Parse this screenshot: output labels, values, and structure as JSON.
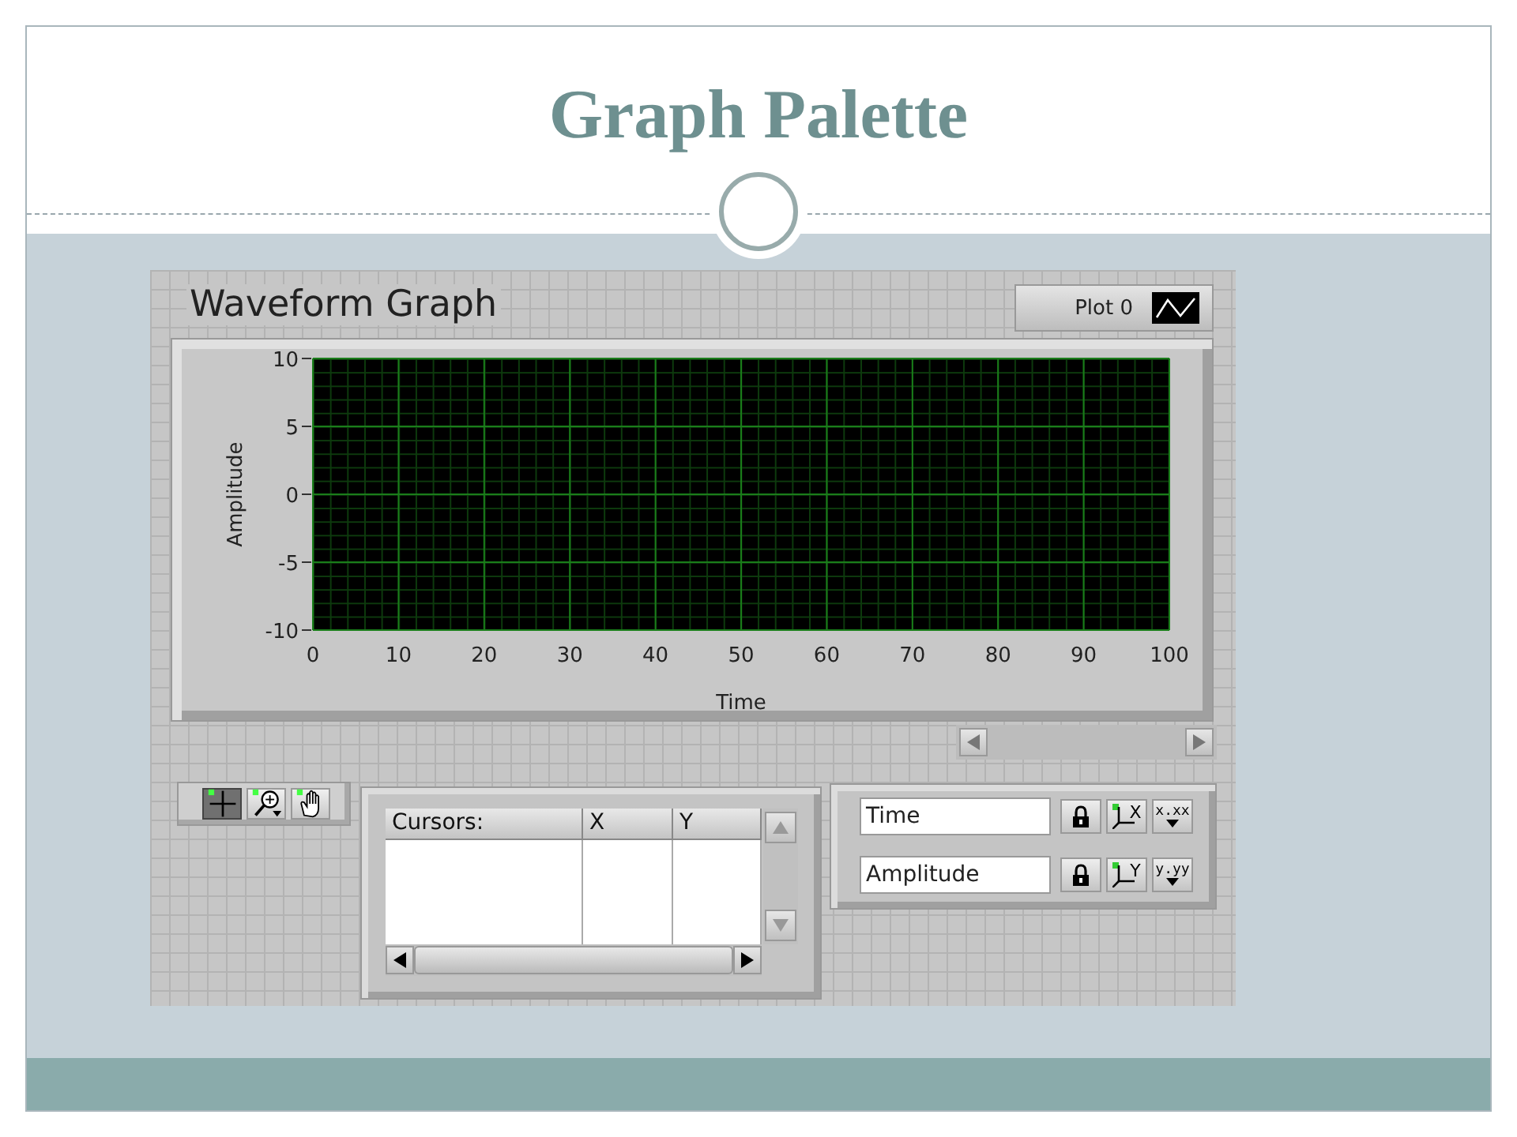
{
  "slide": {
    "title": "Graph Palette"
  },
  "graph": {
    "label": "Waveform Graph",
    "legend": {
      "plot": "Plot 0"
    },
    "chart_data": {
      "type": "line",
      "grid": true,
      "xlabel": "Time",
      "ylabel": "Amplitude",
      "xlim": [
        0,
        100
      ],
      "ylim": [
        -10,
        10
      ],
      "xticks": [
        0,
        10,
        20,
        30,
        40,
        50,
        60,
        70,
        80,
        90,
        100
      ],
      "yticks": [
        -10,
        -5,
        0,
        5,
        10
      ]
    }
  },
  "palette": {
    "tools": [
      {
        "kind": "cursor",
        "selected": true
      },
      {
        "kind": "zoom",
        "selected": false
      },
      {
        "kind": "pan",
        "selected": false
      }
    ]
  },
  "cursor_table": {
    "columns": [
      "Cursors:",
      "X",
      "Y"
    ]
  },
  "scales": [
    {
      "name": "Time",
      "axis_letter": "X",
      "format": "x.xx"
    },
    {
      "name": "Amplitude",
      "axis_letter": "Y",
      "format": "y.yy"
    }
  ]
}
